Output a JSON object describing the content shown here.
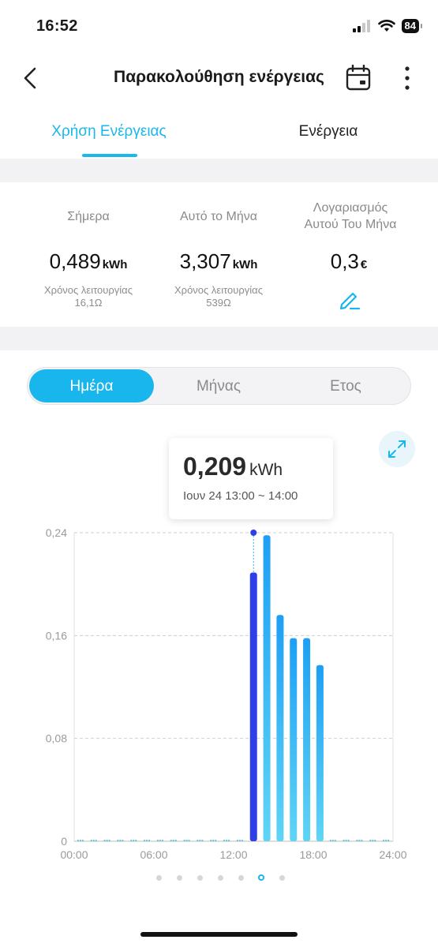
{
  "status_bar": {
    "time": "16:52",
    "battery": "84"
  },
  "header": {
    "title": "Παρακολούθηση ενέργειας",
    "back_icon": "chevron-left-icon",
    "calendar_icon": "calendar-icon",
    "more_icon": "more-vertical-icon"
  },
  "tabs": [
    {
      "label": "Χρήση Ενέργειας",
      "active": true
    },
    {
      "label": "Ενέργεια",
      "active": false
    }
  ],
  "stats": {
    "today": {
      "label": "Σήμερα",
      "value": "0,489",
      "unit": "kWh",
      "runtime_label": "Χρόνος λειτουργίας",
      "runtime": "16,1Ω"
    },
    "month": {
      "label": "Αυτό το Μήνα",
      "value": "3,307",
      "unit": "kWh",
      "runtime_label": "Χρόνος λειτουργίας",
      "runtime": "539Ω"
    },
    "bill": {
      "label_line1": "Λογαριασμός",
      "label_line2": "Αυτού Του Μήνα",
      "value": "0,3",
      "unit": "€",
      "edit_icon": "pencil-icon"
    }
  },
  "segmented": {
    "options": [
      "Ημέρα",
      "Μήνας",
      "Ετος"
    ],
    "selected": 0
  },
  "tooltip": {
    "value": "0,209",
    "unit": "kWh",
    "time": "Ιουν 24 13:00 ~ 14:00"
  },
  "colors": {
    "accent": "#19b6ee",
    "selected_bar": "#2f3fe8",
    "bar_top": "#1e9ff5",
    "bar_bottom": "#5fd5f5"
  },
  "chart_data": {
    "type": "bar",
    "x": [
      0,
      1,
      2,
      3,
      4,
      5,
      6,
      7,
      8,
      9,
      10,
      11,
      12,
      13,
      14,
      15,
      16,
      17,
      18,
      19,
      20,
      21,
      22,
      23
    ],
    "values": [
      0,
      0,
      0,
      0,
      0,
      0,
      0,
      0,
      0,
      0,
      0,
      0,
      0,
      0.209,
      0.238,
      0.176,
      0.158,
      0.158,
      0.137,
      0,
      0,
      0,
      0,
      0
    ],
    "selected_index": 13,
    "ylim": [
      0,
      0.24
    ],
    "y_ticks": [
      "0",
      "0,08",
      "0,16",
      "0,24"
    ],
    "x_ticks": [
      "00:00",
      "06:00",
      "12:00",
      "18:00",
      "24:00"
    ],
    "grid": true
  },
  "pager": {
    "count": 7,
    "active": 5
  }
}
